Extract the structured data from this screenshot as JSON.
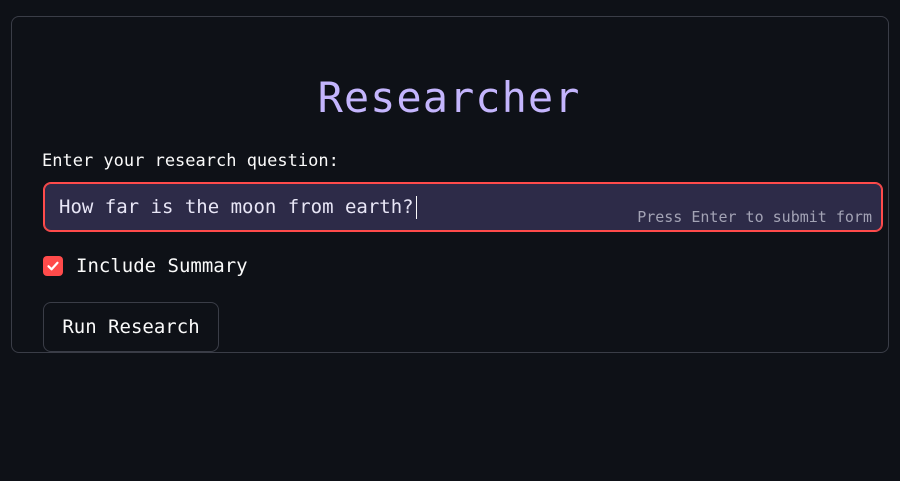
{
  "app": {
    "title": "Researcher"
  },
  "form": {
    "question_label": "Enter your research question:",
    "question_value": "How far is the moon from earth?",
    "question_hint": "Press Enter to submit form",
    "summary_checkbox": {
      "label": "Include Summary",
      "checked": true
    },
    "run_button_label": "Run Research"
  },
  "colors": {
    "background": "#0e1117",
    "title": "#c4b5fd",
    "accent": "#ff4b4b",
    "input_background": "#2d2b48"
  },
  "icons": {
    "checkbox": "checkmark-icon"
  }
}
